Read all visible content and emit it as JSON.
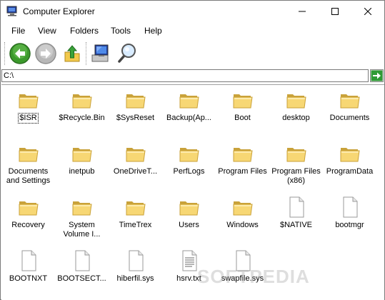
{
  "window": {
    "title": "Computer Explorer",
    "icon": "computer-icon",
    "controls": [
      "minimize",
      "maximize",
      "close"
    ]
  },
  "menu": [
    "File",
    "View",
    "Folders",
    "Tools",
    "Help"
  ],
  "toolbar": {
    "buttons": [
      {
        "name": "back",
        "icon": "back-arrow-icon",
        "enabled": true,
        "color": "#3c9a2c"
      },
      {
        "name": "forward",
        "icon": "forward-arrow-icon",
        "enabled": false,
        "color": "#9a9a9a"
      },
      {
        "name": "up",
        "icon": "up-folder-icon",
        "enabled": true
      },
      {
        "name": "computer",
        "icon": "computer-icon",
        "enabled": true
      },
      {
        "name": "search",
        "icon": "magnifier-icon",
        "enabled": true
      }
    ]
  },
  "address": {
    "value": "C:\\",
    "go_icon": "go-arrow-icon"
  },
  "items": [
    {
      "label": "$ISR",
      "type": "folder",
      "selected": true
    },
    {
      "label": "$Recycle.Bin",
      "type": "folder"
    },
    {
      "label": "$SysReset",
      "type": "folder"
    },
    {
      "label": "Backup(Ap...",
      "type": "folder"
    },
    {
      "label": "Boot",
      "type": "folder"
    },
    {
      "label": "desktop",
      "type": "folder"
    },
    {
      "label": "Documents",
      "type": "folder"
    },
    {
      "label": "Documents\nand Settings",
      "type": "folder"
    },
    {
      "label": "inetpub",
      "type": "folder"
    },
    {
      "label": "OneDriveT...",
      "type": "folder"
    },
    {
      "label": "PerfLogs",
      "type": "folder"
    },
    {
      "label": "Program Files",
      "type": "folder"
    },
    {
      "label": "Program Files\n(x86)",
      "type": "folder"
    },
    {
      "label": "ProgramData",
      "type": "folder"
    },
    {
      "label": "Recovery",
      "type": "folder"
    },
    {
      "label": "System\nVolume I...",
      "type": "folder"
    },
    {
      "label": "TimeTrex",
      "type": "folder"
    },
    {
      "label": "Users",
      "type": "folder"
    },
    {
      "label": "Windows",
      "type": "folder"
    },
    {
      "label": "$NATIVE",
      "type": "file"
    },
    {
      "label": "bootmgr",
      "type": "file"
    },
    {
      "label": "BOOTNXT",
      "type": "file"
    },
    {
      "label": "BOOTSECT...",
      "type": "file"
    },
    {
      "label": "hiberfil.sys",
      "type": "file"
    },
    {
      "label": "hsrv.txt",
      "type": "text"
    },
    {
      "label": "swapfile.sys",
      "type": "file"
    }
  ],
  "watermark": "SOFTPEDIA",
  "colors": {
    "folder_fill": "#f7d774",
    "folder_edge": "#c9a23a"
  }
}
